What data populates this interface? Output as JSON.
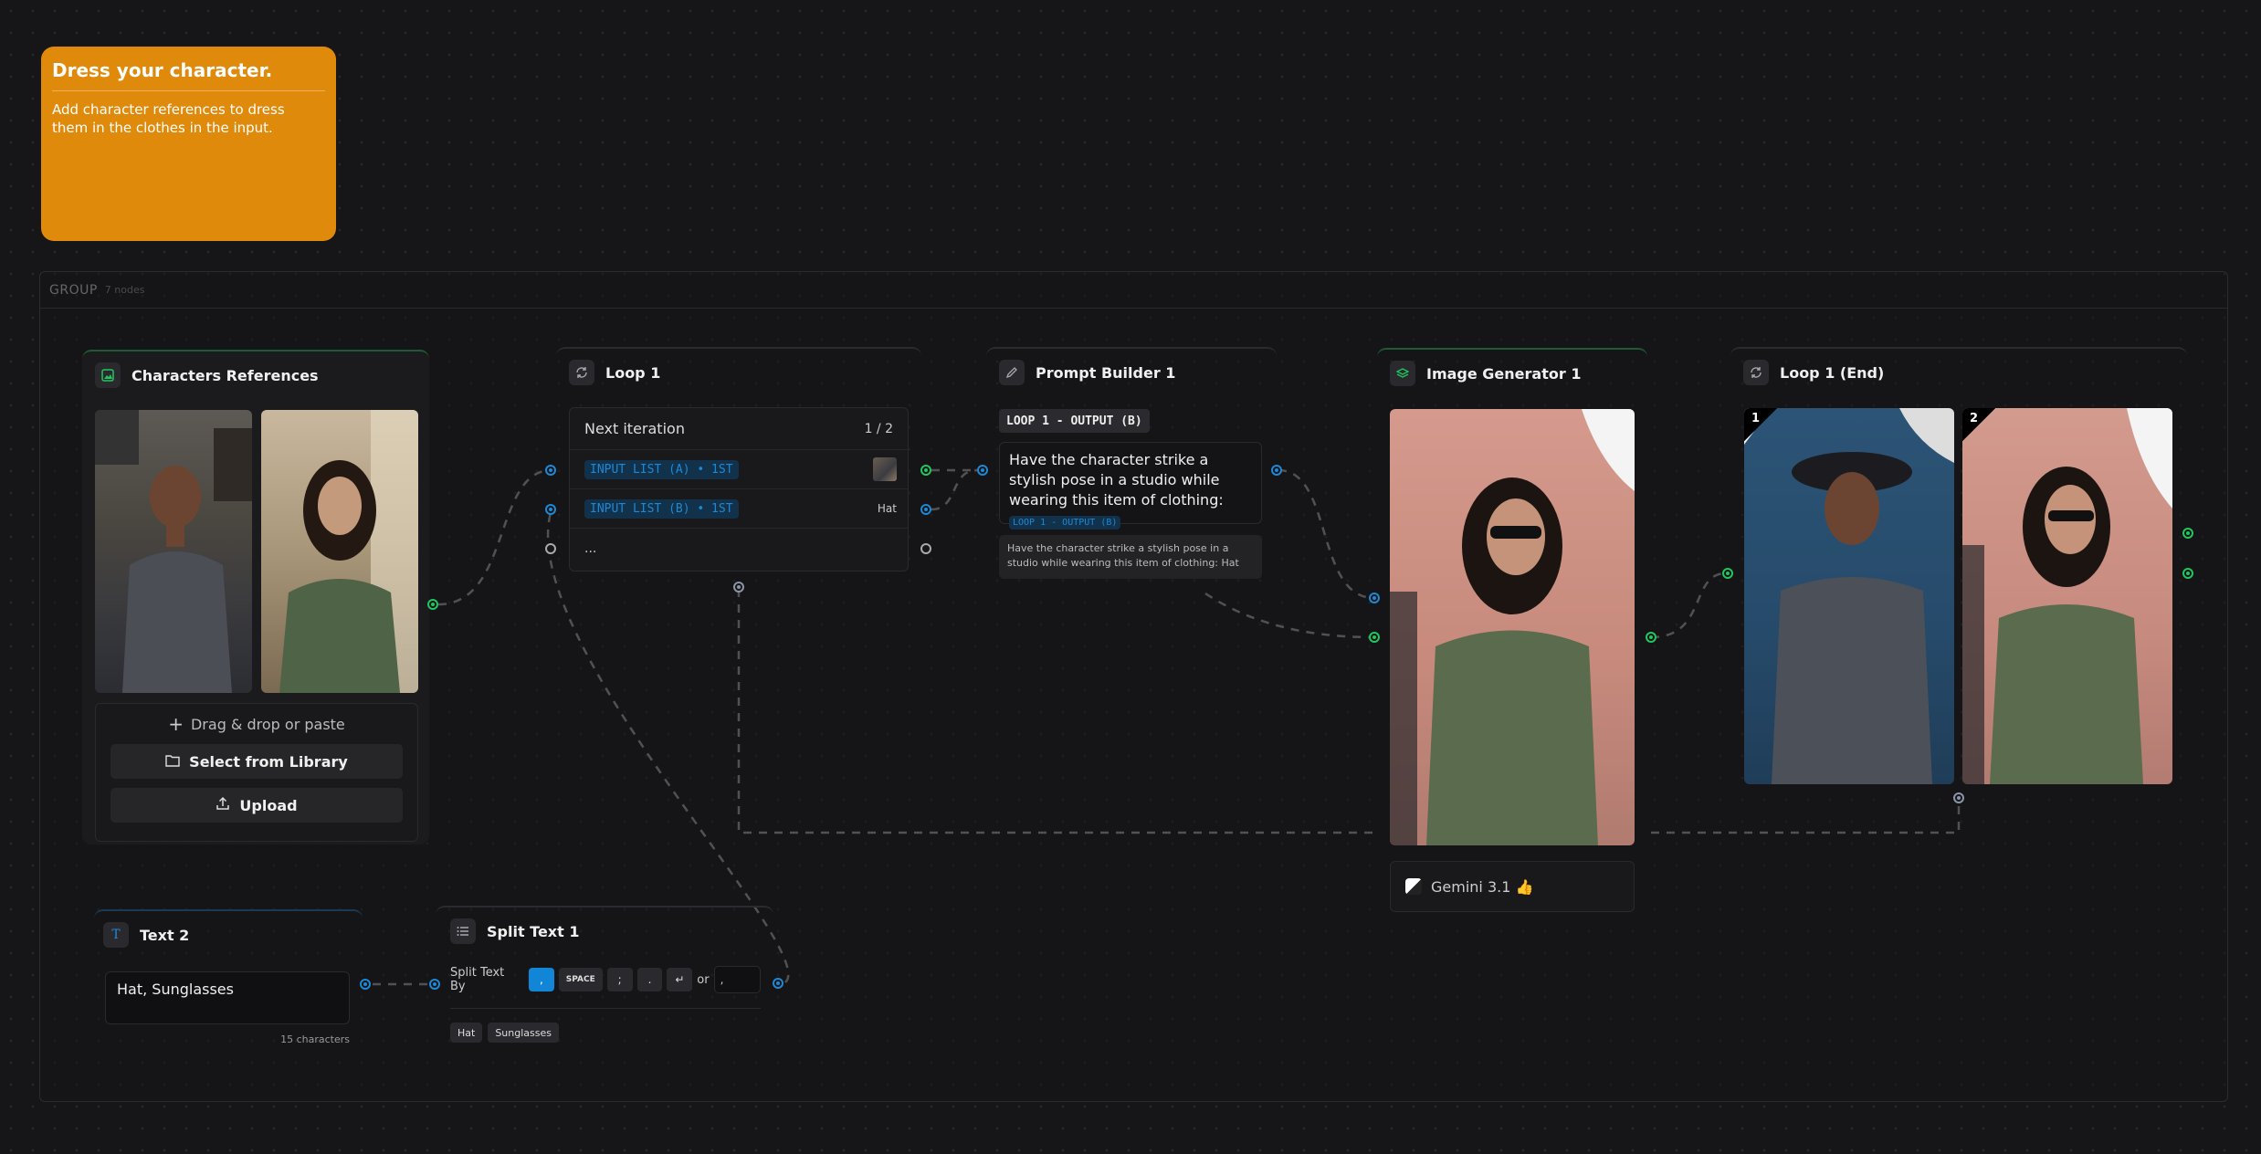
{
  "note": {
    "title": "Dress your character.",
    "body": "Add character references to dress them in the clothes in the input."
  },
  "group": {
    "label": "GROUP",
    "count": "7 nodes"
  },
  "characters_references": {
    "title": "Characters References",
    "drag_drop": "Drag & drop or paste",
    "select_library": "Select from Library",
    "upload": "Upload"
  },
  "loop1": {
    "title": "Loop 1",
    "next_iteration": "Next iteration",
    "progress": "1 / 2",
    "rows": [
      {
        "tag": "INPUT LIST (A) • 1ST",
        "value": ""
      },
      {
        "tag": "INPUT LIST (B) • 1ST",
        "value": "Hat"
      }
    ],
    "more": "..."
  },
  "prompt_builder": {
    "title": "Prompt Builder 1",
    "variable": "LOOP 1 - OUTPUT (B)",
    "template": "Have the character strike a stylish pose in a studio while wearing this item of clothing:",
    "inline_tag": "LOOP 1 - OUTPUT (B)",
    "preview": "Have the character strike a stylish pose in a studio while wearing this item of clothing: Hat"
  },
  "image_generator": {
    "title": "Image Generator 1",
    "model": "Gemini 3.1 👍"
  },
  "loop_end": {
    "title": "Loop 1 (End)",
    "badges": [
      "1",
      "2"
    ]
  },
  "text2": {
    "title": "Text 2",
    "value": "Hat, Sunglasses",
    "char_count": "15 characters"
  },
  "split_text": {
    "title": "Split Text 1",
    "label": "Split Text By",
    "delimiters": [
      ",",
      "SPACE",
      ";",
      ".",
      "↵"
    ],
    "or_label": "or",
    "custom_value": ",",
    "outputs": [
      "Hat",
      "Sunglasses"
    ]
  },
  "colors": {
    "note": "#e08a0b",
    "accent_blue": "#1e88d6",
    "accent_green": "#22c55e",
    "background": "#161618"
  }
}
